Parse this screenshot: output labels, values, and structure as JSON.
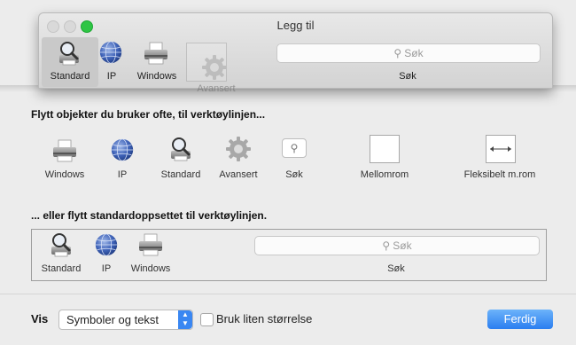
{
  "window": {
    "title": "Legg til",
    "toolbar": [
      {
        "label": "Standard",
        "icon": "printer-search-icon",
        "selected": true
      },
      {
        "label": "IP",
        "icon": "globe-icon",
        "selected": false
      },
      {
        "label": "Windows",
        "icon": "printer-icon",
        "selected": false
      }
    ],
    "search_placeholder": "Søk",
    "search_label": "Søk"
  },
  "drag": {
    "label": "Avansert",
    "icon": "gear-icon"
  },
  "custom_section": {
    "title": "Flytt objekter du bruker ofte, til verktøylinjen...",
    "items": [
      {
        "label": "Windows",
        "icon": "printer-icon"
      },
      {
        "label": "IP",
        "icon": "globe-icon"
      },
      {
        "label": "Standard",
        "icon": "printer-search-icon"
      },
      {
        "label": "Avansert",
        "icon": "gear-icon"
      },
      {
        "label": "Søk",
        "icon": "search-icon"
      },
      {
        "label": "Mellomrom",
        "icon": "space-box-icon"
      },
      {
        "label": "Fleksibelt m.rom",
        "icon": "flexible-space-icon"
      }
    ]
  },
  "default_section": {
    "title": "... eller flytt standardoppsettet til verktøylinjen.",
    "items": [
      {
        "label": "Standard",
        "icon": "printer-search-icon"
      },
      {
        "label": "IP",
        "icon": "globe-icon"
      },
      {
        "label": "Windows",
        "icon": "printer-icon"
      }
    ],
    "search_placeholder": "Søk",
    "search_label": "Søk"
  },
  "bottom": {
    "show_label": "Vis",
    "select_value": "Symboler og tekst",
    "checkbox_label": "Bruk liten størrelse",
    "checkbox_checked": false,
    "done_label": "Ferdig"
  },
  "colors": {
    "accent": "#2a7ef0",
    "green_light": "#2ec544"
  }
}
